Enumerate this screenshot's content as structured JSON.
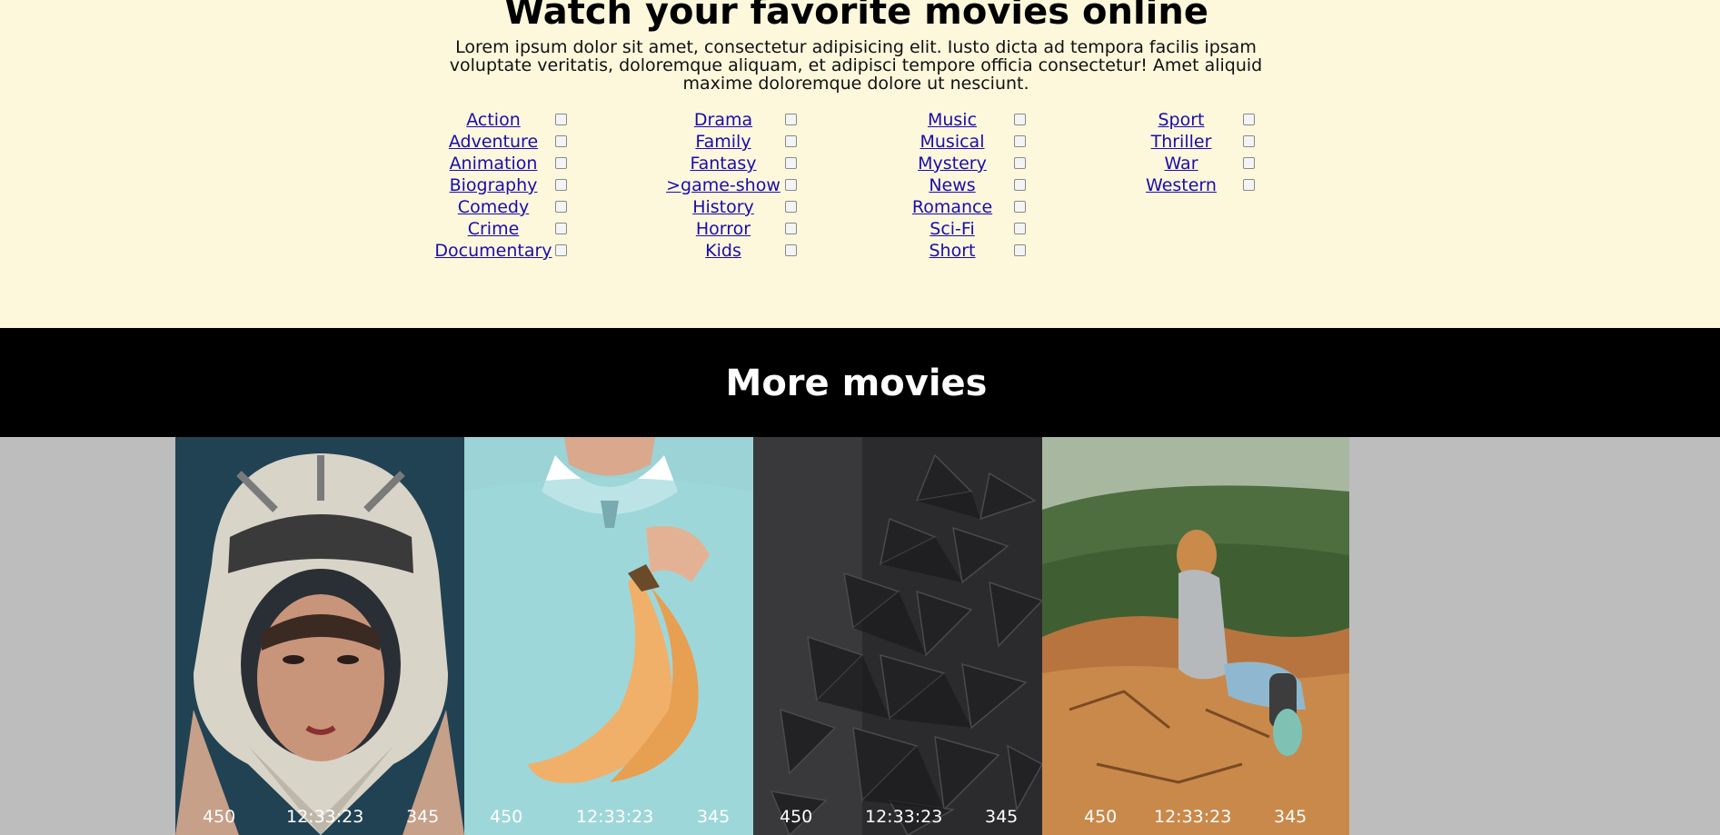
{
  "hero": {
    "title": "Watch your favorite movies online",
    "description": "Lorem ipsum dolor sit amet, consectetur adipisicing elit. Iusto dicta ad tempora facilis ipsam voluptate veritatis, doloremque aliquam, et adipisci tempore officia consectetur! Amet aliquid maxime doloremque dolore ut nesciunt."
  },
  "genres": {
    "col1": [
      "Action",
      "Adventure",
      "Animation",
      "Biography",
      "Comedy",
      "Crime",
      "Documentary"
    ],
    "col2": [
      "Drama",
      "Family",
      "Fantasy",
      ">game-show",
      "History",
      "Horror",
      "Kids"
    ],
    "col3": [
      "Music",
      "Musical",
      "Mystery",
      "News",
      "Romance",
      "Sci-Fi",
      "Short"
    ],
    "col4": [
      "Sport",
      "Thriller",
      "War",
      "Western"
    ]
  },
  "banner": {
    "title": "More movies"
  },
  "movies": [
    {
      "left_stat": "450",
      "time": "12:33:23",
      "right_stat": "345",
      "image": "helmet-woman-photo"
    },
    {
      "left_stat": "450",
      "time": "12:33:23",
      "right_stat": "345",
      "image": "man-holding-bananas-photo"
    },
    {
      "left_stat": "450",
      "time": "12:33:23",
      "right_stat": "345",
      "image": "dark-3d-pyramids-photo"
    },
    {
      "left_stat": "450",
      "time": "12:33:23",
      "right_stat": "345",
      "image": "woman-on-cliff-photo"
    }
  ],
  "colors": {
    "hero_bg": "#fdf7dc",
    "banner_bg": "#000000",
    "link": "#1a0dab",
    "page_bg": "#bdbdbd"
  }
}
